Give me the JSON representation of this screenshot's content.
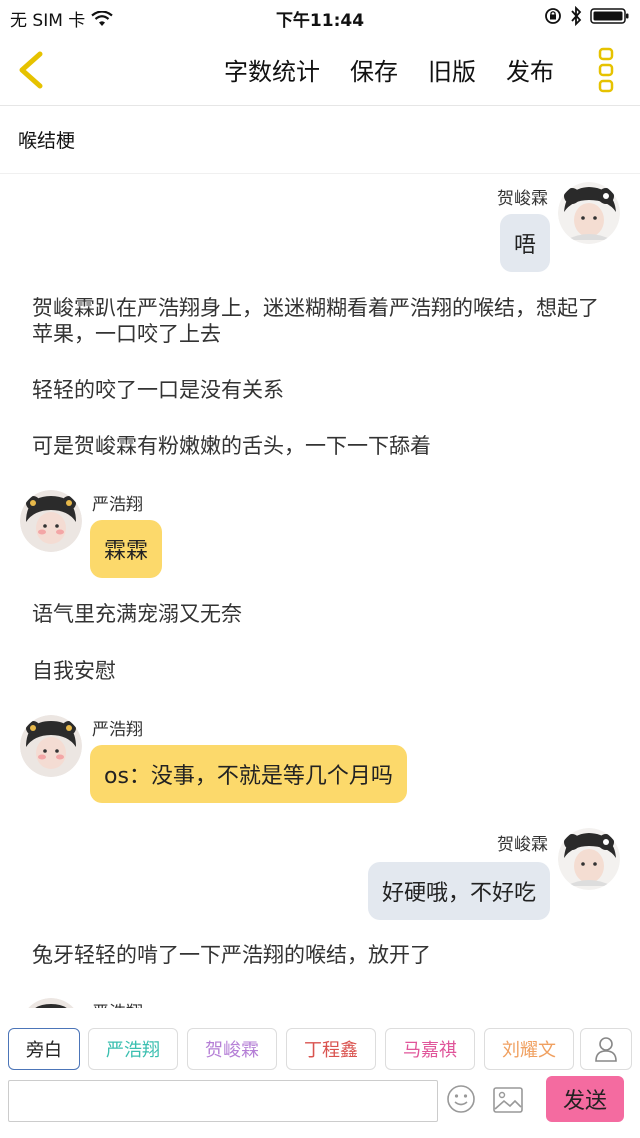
{
  "status": {
    "carrier": "无 SIM 卡",
    "time": "下午11:44"
  },
  "nav": {
    "word_count": "字数统计",
    "save": "保存",
    "old_version": "旧版",
    "publish": "发布"
  },
  "title": "喉结梗",
  "messages": [
    {
      "type": "dialog",
      "side": "right",
      "name": "贺峻霖",
      "text": "唔"
    },
    {
      "type": "narration",
      "text": "贺峻霖趴在严浩翔身上，迷迷糊糊看着严浩翔的喉结，想起了苹果，一口咬了上去"
    },
    {
      "type": "narration",
      "text": "轻轻的咬了一口是没有关系"
    },
    {
      "type": "narration",
      "text": "可是贺峻霖有粉嫩嫩的舌头，一下一下舔着"
    },
    {
      "type": "dialog",
      "side": "left",
      "name": "严浩翔",
      "text": "霖霖"
    },
    {
      "type": "narration",
      "text": "语气里充满宠溺又无奈"
    },
    {
      "type": "narration",
      "text": "自我安慰"
    },
    {
      "type": "dialog",
      "side": "left",
      "name": "严浩翔",
      "text": "os：没事，不就是等几个月吗"
    },
    {
      "type": "dialog",
      "side": "right",
      "name": "贺峻霖",
      "text": "好硬哦，不好吃"
    },
    {
      "type": "narration",
      "text": "兔牙轻轻的啃了一下严浩翔的喉结，放开了"
    },
    {
      "type": "dialog",
      "side": "left",
      "name": "严浩翔",
      "text": ""
    }
  ],
  "roles": [
    {
      "label": "旁白",
      "color": "#222222",
      "active": true
    },
    {
      "label": "严浩翔",
      "color": "#3bbfb0"
    },
    {
      "label": "贺峻霖",
      "color": "#b57fd6"
    },
    {
      "label": "丁程鑫",
      "color": "#d9534f"
    },
    {
      "label": "马嘉祺",
      "color": "#e0559a"
    },
    {
      "label": "刘耀文",
      "color": "#f0a060"
    }
  ],
  "input": {
    "value": "",
    "send_label": "发送"
  },
  "colors": {
    "left_bubble": "#fcd96b",
    "right_bubble": "#e3e8ef",
    "send_button": "#f46ba0",
    "accent": "#e6c200"
  }
}
